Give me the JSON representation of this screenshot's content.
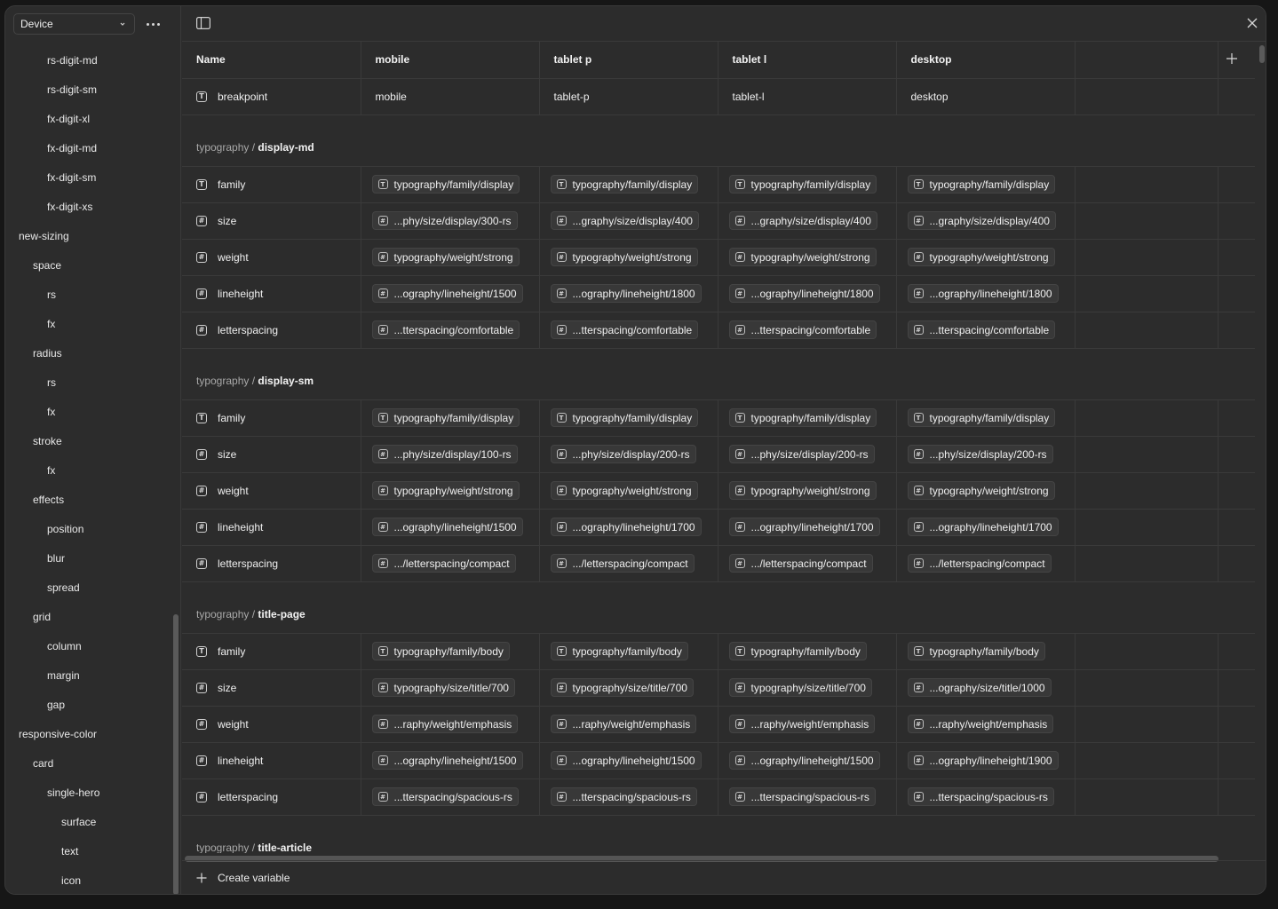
{
  "sidebar": {
    "mode_label": "Device",
    "items": [
      {
        "label": "rs-digit-md",
        "level": 2
      },
      {
        "label": "rs-digit-sm",
        "level": 2
      },
      {
        "label": "fx-digit-xl",
        "level": 2
      },
      {
        "label": "fx-digit-md",
        "level": 2
      },
      {
        "label": "fx-digit-sm",
        "level": 2
      },
      {
        "label": "fx-digit-xs",
        "level": 2
      },
      {
        "label": "new-sizing",
        "level": 0
      },
      {
        "label": "space",
        "level": 1
      },
      {
        "label": "rs",
        "level": 2
      },
      {
        "label": "fx",
        "level": 2
      },
      {
        "label": "radius",
        "level": 1
      },
      {
        "label": "rs",
        "level": 2
      },
      {
        "label": "fx",
        "level": 2
      },
      {
        "label": "stroke",
        "level": 1
      },
      {
        "label": "fx",
        "level": 2
      },
      {
        "label": "effects",
        "level": 1
      },
      {
        "label": "position",
        "level": 2
      },
      {
        "label": "blur",
        "level": 2
      },
      {
        "label": "spread",
        "level": 2
      },
      {
        "label": "grid",
        "level": 1
      },
      {
        "label": "column",
        "level": 2
      },
      {
        "label": "margin",
        "level": 2
      },
      {
        "label": "gap",
        "level": 2
      },
      {
        "label": "responsive-color",
        "level": 0
      },
      {
        "label": "card",
        "level": 1
      },
      {
        "label": "single-hero",
        "level": 2
      },
      {
        "label": "surface",
        "level": 3
      },
      {
        "label": "text",
        "level": 3
      },
      {
        "label": "icon",
        "level": 3
      }
    ]
  },
  "table": {
    "headers": {
      "name": "Name",
      "modes": [
        "mobile",
        "tablet p",
        "tablet l",
        "desktop"
      ]
    },
    "breakpoint_row": {
      "name": "breakpoint",
      "icon": "text-type-icon",
      "values": [
        "mobile",
        "tablet-p",
        "tablet-l",
        "desktop"
      ]
    },
    "groups": [
      {
        "prefix": "typography / ",
        "name": "display-md",
        "rows": [
          {
            "name": "family",
            "icon": "text-type-icon",
            "values": [
              "typography/family/display",
              "typography/family/display",
              "typography/family/display",
              "typography/family/display"
            ],
            "value_icon": "text-type-icon"
          },
          {
            "name": "size",
            "icon": "number-type-icon",
            "values": [
              "...phy/size/display/300-rs",
              "...graphy/size/display/400",
              "...graphy/size/display/400",
              "...graphy/size/display/400"
            ],
            "value_icon": "number-type-icon"
          },
          {
            "name": "weight",
            "icon": "number-type-icon",
            "values": [
              "typography/weight/strong",
              "typography/weight/strong",
              "typography/weight/strong",
              "typography/weight/strong"
            ],
            "value_icon": "number-type-icon"
          },
          {
            "name": "lineheight",
            "icon": "number-type-icon",
            "values": [
              "...ography/lineheight/1500",
              "...ography/lineheight/1800",
              "...ography/lineheight/1800",
              "...ography/lineheight/1800"
            ],
            "value_icon": "number-type-icon"
          },
          {
            "name": "letterspacing",
            "icon": "number-type-icon",
            "values": [
              "...tterspacing/comfortable",
              "...tterspacing/comfortable",
              "...tterspacing/comfortable",
              "...tterspacing/comfortable"
            ],
            "value_icon": "number-type-icon"
          }
        ]
      },
      {
        "prefix": "typography / ",
        "name": "display-sm",
        "rows": [
          {
            "name": "family",
            "icon": "text-type-icon",
            "values": [
              "typography/family/display",
              "typography/family/display",
              "typography/family/display",
              "typography/family/display"
            ],
            "value_icon": "text-type-icon"
          },
          {
            "name": "size",
            "icon": "number-type-icon",
            "values": [
              "...phy/size/display/100-rs",
              "...phy/size/display/200-rs",
              "...phy/size/display/200-rs",
              "...phy/size/display/200-rs"
            ],
            "value_icon": "number-type-icon"
          },
          {
            "name": "weight",
            "icon": "number-type-icon",
            "values": [
              "typography/weight/strong",
              "typography/weight/strong",
              "typography/weight/strong",
              "typography/weight/strong"
            ],
            "value_icon": "number-type-icon"
          },
          {
            "name": "lineheight",
            "icon": "number-type-icon",
            "values": [
              "...ography/lineheight/1500",
              "...ography/lineheight/1700",
              "...ography/lineheight/1700",
              "...ography/lineheight/1700"
            ],
            "value_icon": "number-type-icon"
          },
          {
            "name": "letterspacing",
            "icon": "number-type-icon",
            "values": [
              ".../letterspacing/compact",
              ".../letterspacing/compact",
              ".../letterspacing/compact",
              ".../letterspacing/compact"
            ],
            "value_icon": "number-type-icon"
          }
        ]
      },
      {
        "prefix": "typography / ",
        "name": "title-page",
        "rows": [
          {
            "name": "family",
            "icon": "text-type-icon",
            "values": [
              "typography/family/body",
              "typography/family/body",
              "typography/family/body",
              "typography/family/body"
            ],
            "value_icon": "text-type-icon"
          },
          {
            "name": "size",
            "icon": "number-type-icon",
            "values": [
              "typography/size/title/700",
              "typography/size/title/700",
              "typography/size/title/700",
              "...ography/size/title/1000"
            ],
            "value_icon": "number-type-icon"
          },
          {
            "name": "weight",
            "icon": "number-type-icon",
            "values": [
              "...raphy/weight/emphasis",
              "...raphy/weight/emphasis",
              "...raphy/weight/emphasis",
              "...raphy/weight/emphasis"
            ],
            "value_icon": "number-type-icon"
          },
          {
            "name": "lineheight",
            "icon": "number-type-icon",
            "values": [
              "...ography/lineheight/1500",
              "...ography/lineheight/1500",
              "...ography/lineheight/1500",
              "...ography/lineheight/1900"
            ],
            "value_icon": "number-type-icon"
          },
          {
            "name": "letterspacing",
            "icon": "number-type-icon",
            "values": [
              "...tterspacing/spacious-rs",
              "...tterspacing/spacious-rs",
              "...tterspacing/spacious-rs",
              "...tterspacing/spacious-rs"
            ],
            "value_icon": "number-type-icon"
          }
        ]
      },
      {
        "prefix": "typography / ",
        "name": "title-article",
        "rows": []
      }
    ]
  },
  "footer": {
    "create_label": "Create variable"
  }
}
